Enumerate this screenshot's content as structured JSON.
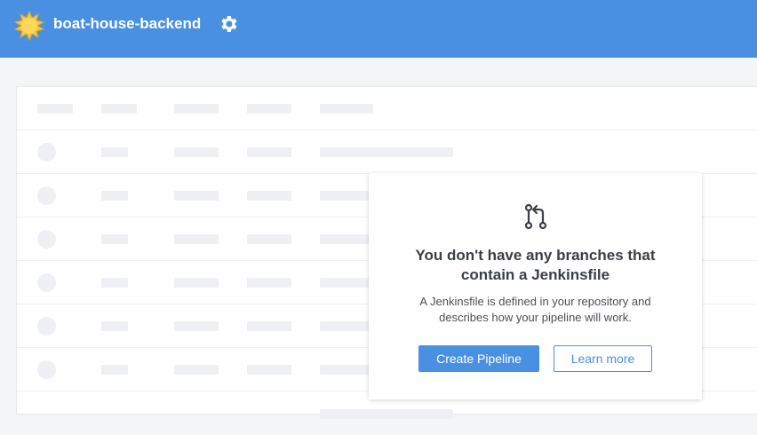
{
  "header": {
    "pipeline_name": "boat-house-backend",
    "logo_icon": "jenkins-sun-icon",
    "settings_icon": "gear-icon",
    "background_color": "#4a90e2"
  },
  "empty_state": {
    "icon": "git-branch-icon",
    "title_line1": "You don't have any branches that",
    "title_line2": "contain a Jenkinsfile",
    "description_line1": "A Jenkinsfile is defined in your repository and",
    "description_line2": "describes how your pipeline will work.",
    "primary_button": "Create Pipeline",
    "secondary_button": "Learn more"
  },
  "placeholder_table": {
    "row_count": 7,
    "color": "#eef0f3"
  }
}
